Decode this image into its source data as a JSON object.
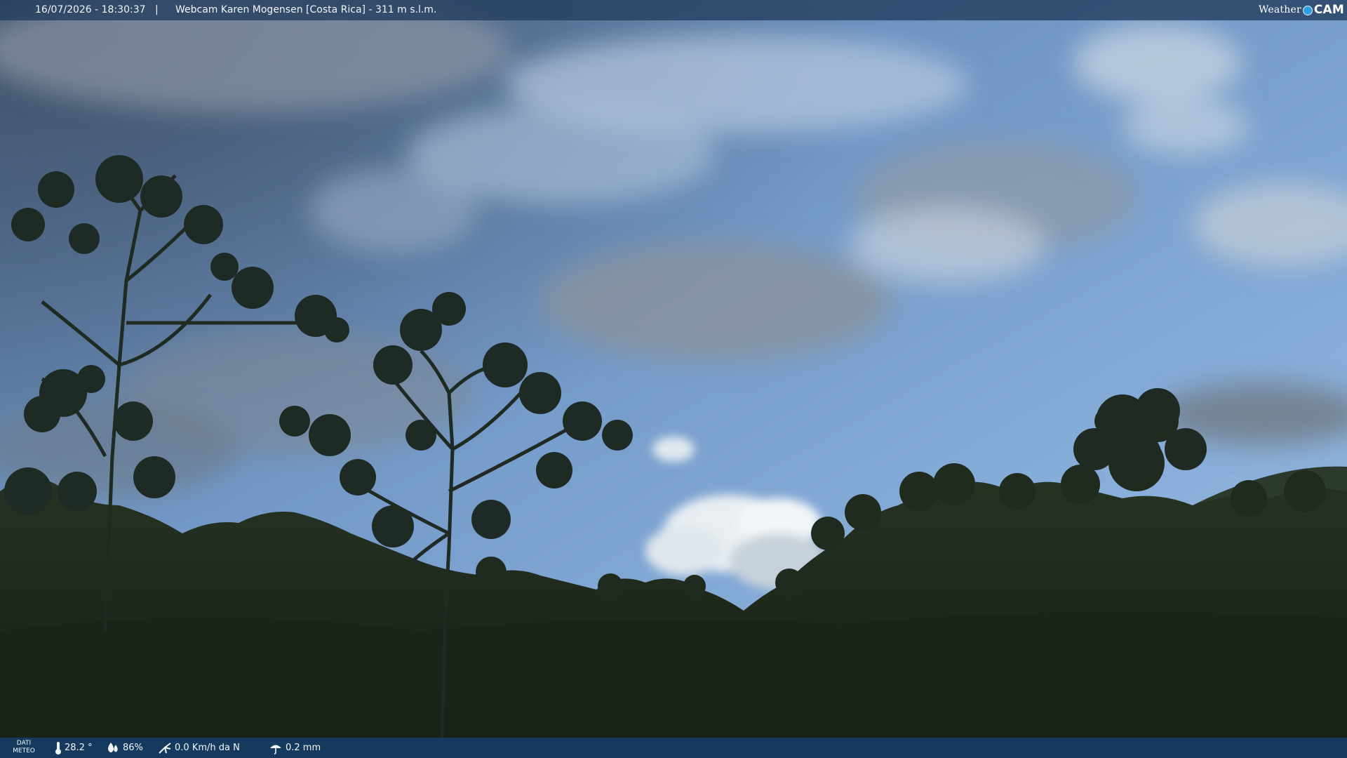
{
  "overlay_top": {
    "datetime": "16/07/2026 - 18:30:37",
    "separator": "|",
    "title": "Webcam Karen Mogensen [Costa Rica]  - 311 m s.l.m.",
    "logo_text_a": "Weather",
    "logo_text_b": "CAM"
  },
  "overlay_bottom": {
    "section_label": "DATI\nMETEO",
    "temperature": "28.2 °",
    "humidity": "86%",
    "wind": "0.0 Km/h da N",
    "rain": "0.2 mm"
  },
  "icons": [
    "thermometer-icon",
    "humidity-icon",
    "wind-icon",
    "rain-icon",
    "weathercam-logo-icon"
  ],
  "colors": {
    "sky_top": "#5d7ea8",
    "sky_mid": "#7fa6d2",
    "clouds": "#c9d6e3",
    "vegetation": "#1f2a1d",
    "bar_top": "#264060",
    "bar_bottom": "#163e6a"
  }
}
